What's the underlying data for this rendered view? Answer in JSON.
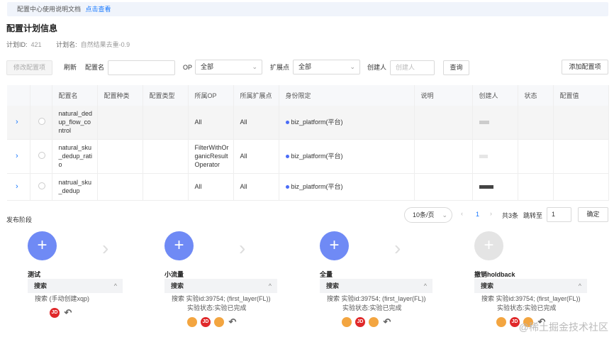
{
  "notice": {
    "text": "配置中心使用说明文档",
    "link": "点击查看"
  },
  "page_title": "配置计划信息",
  "meta": {
    "plan_id_label": "计划ID:",
    "plan_id": "421",
    "plan_name_label": "计划名:",
    "plan_name": "自然结果去重-0.9"
  },
  "toolbar": {
    "modify_btn": "修改配置项",
    "refresh": "刷新",
    "config_name_label": "配置名",
    "op_label": "OP",
    "op_value": "全部",
    "ext_label": "扩展点",
    "ext_value": "全部",
    "creator_label": "创建人",
    "creator_placeholder": "创建人",
    "query_btn": "查询",
    "add_btn": "添加配置项"
  },
  "table": {
    "headers": [
      "配置名",
      "配置种类",
      "配置类型",
      "所属OP",
      "所属扩展点",
      "身份限定",
      "说明",
      "创建人",
      "状态",
      "配置值"
    ],
    "rows": [
      {
        "name": "natural_ded up_flow_co ntrol",
        "op": "All",
        "ext": "All",
        "identity": "biz_platform(平台)"
      },
      {
        "name": "natural_sku _dedup_rati o",
        "op": "FilterWithOr ganicResult Operator",
        "ext": "All",
        "identity": "biz_platform(平台)"
      },
      {
        "name": "natrual_sku _dedup",
        "op": "All",
        "ext": "All",
        "identity": "biz_platform(平台)"
      }
    ]
  },
  "pagination": {
    "page_size": "10条/页",
    "current": "1",
    "total": "共3条",
    "jump_label": "跳转至",
    "jump_value": "1",
    "confirm": "确定"
  },
  "stages_label": "发布阶段",
  "stages": [
    {
      "title": "测试",
      "bar": "搜索",
      "line1": "搜索 (手动创建xqp)",
      "line2": ""
    },
    {
      "title": "小流量",
      "bar": "搜索",
      "line1": "搜索 实验id:39754;  (first_layer(FL))",
      "line2": "实验状态:实验已完成"
    },
    {
      "title": "全量",
      "bar": "搜索",
      "line1": "搜索 实验id:39754;  (first_layer(FL))",
      "line2": "实验状态:实验已完成"
    },
    {
      "title": "撤销holdback",
      "bar": "搜索",
      "line1": "搜索 实验id:39754;  (first_layer(FL))",
      "line2": "实验状态:实验已完成"
    }
  ],
  "icons": {
    "jd": "JD",
    "plus": "+",
    "arrow": "›",
    "chevron_up": "^",
    "back": "↶"
  },
  "watermark": "@稀土掘金技术社区",
  "colors": {
    "accent": "#1677ff",
    "circle": "#6f8af5",
    "jd": "#e0282a",
    "gear": "#f3a540"
  }
}
